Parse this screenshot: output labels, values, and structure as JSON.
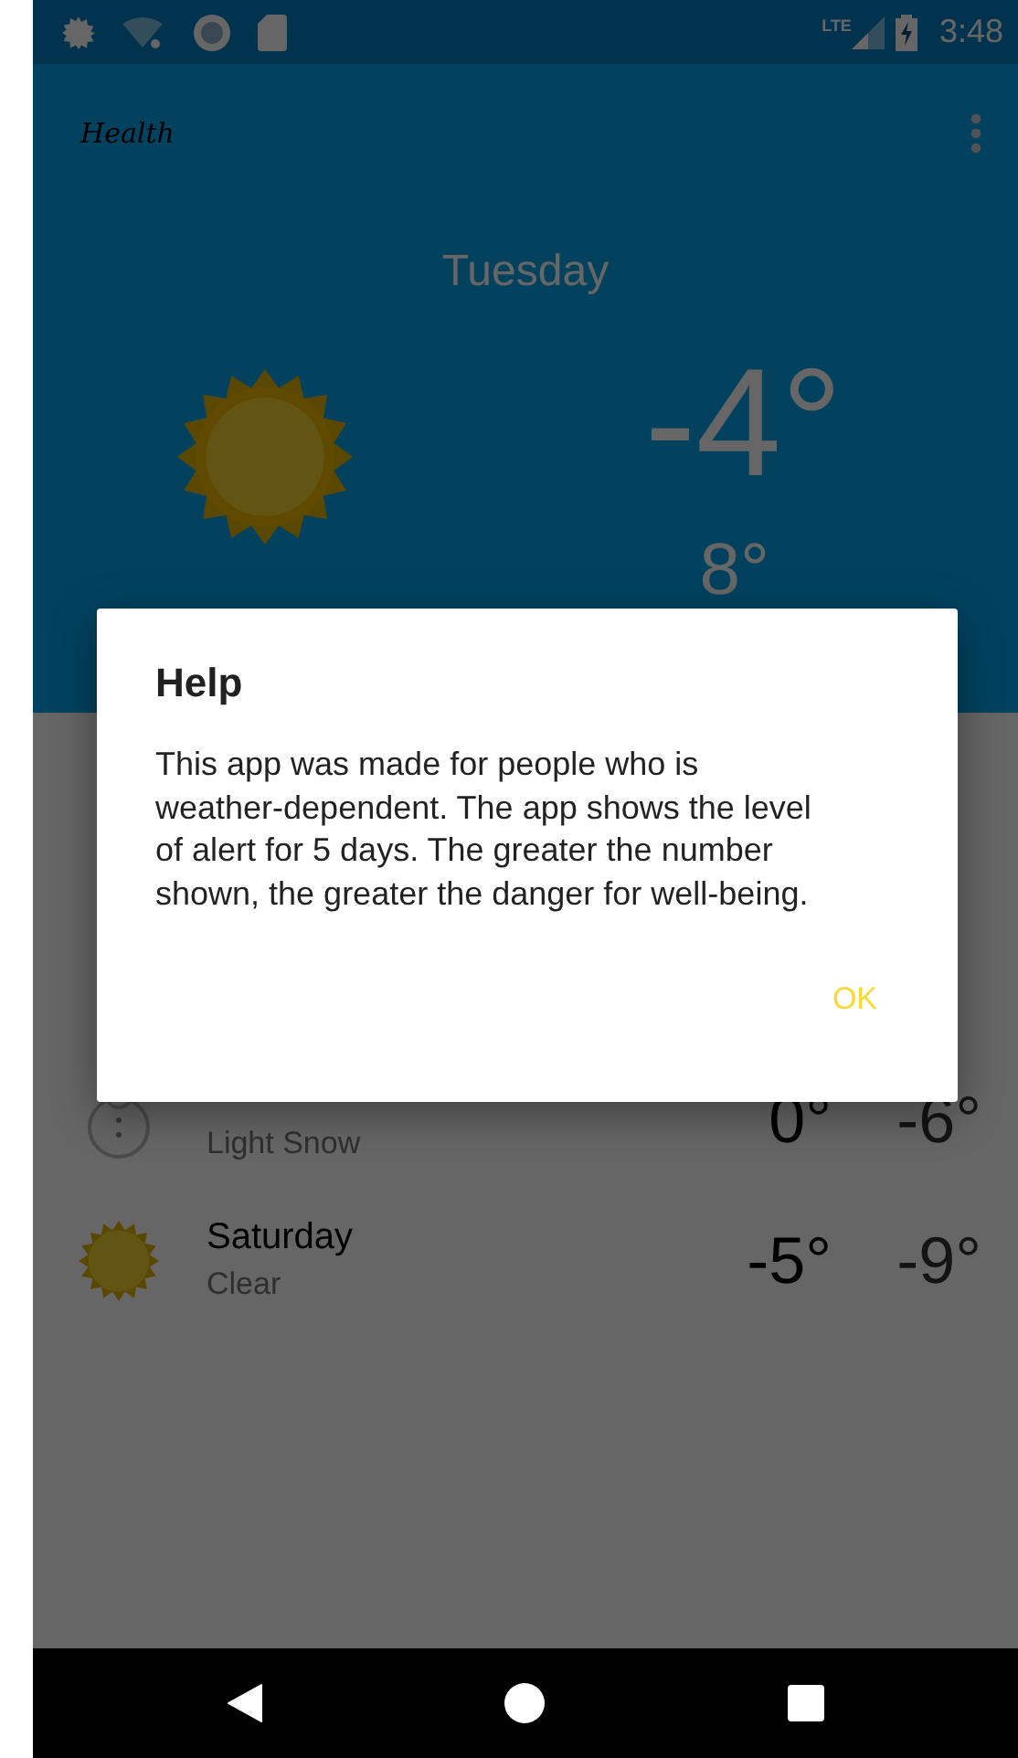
{
  "status_bar": {
    "network": "LTE",
    "time": "3:48"
  },
  "app_bar": {
    "title": "Health"
  },
  "today": {
    "day": "Tuesday",
    "main_temperature": "-4°",
    "second_temperature": "8°"
  },
  "forecast": [
    {
      "condition": "Light Snow",
      "high": "0°",
      "low": "-6°",
      "kind": "snow"
    },
    {
      "day": "Saturday",
      "condition": "Clear",
      "high": "-5°",
      "low": "-9°",
      "kind": "sun"
    }
  ],
  "dialog": {
    "title": "Help",
    "message": "This app was made for people who is weather-dependent. The app shows the level of alert for 5 days. The greater the number shown, the greater the danger for well-being.",
    "button": "OK"
  }
}
